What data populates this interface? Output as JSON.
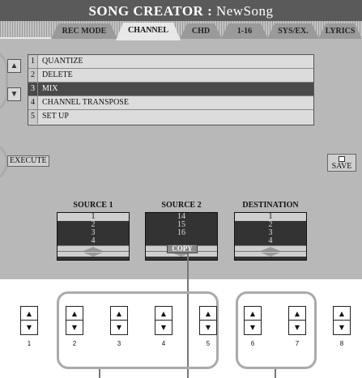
{
  "title": {
    "prefix": "SONG CREATOR : ",
    "name": "NewSong"
  },
  "tabs": [
    "REC MODE",
    "CHANNEL",
    "CHD",
    "1-16",
    "SYS/EX.",
    "LYRICS"
  ],
  "active_tab": "CHANNEL",
  "scroll": {
    "up": "▲",
    "down": "▼"
  },
  "menu": [
    {
      "num": "1",
      "label": "QUANTIZE"
    },
    {
      "num": "2",
      "label": "DELETE"
    },
    {
      "num": "3",
      "label": "MIX"
    },
    {
      "num": "4",
      "label": "CHANNEL TRANSPOSE"
    },
    {
      "num": "5",
      "label": "SET UP"
    }
  ],
  "selected_menu": "MIX",
  "execute_label": "EXECUTE",
  "save_label": "SAVE",
  "columns": [
    {
      "title": "SOURCE 1",
      "rows": [
        "1",
        "2",
        "3",
        "4"
      ],
      "selected": "1"
    },
    {
      "title": "SOURCE 2",
      "rows": [
        "14",
        "15",
        "16"
      ],
      "selected": ""
    },
    {
      "title": "DESTINATION",
      "rows": [
        "1",
        "2",
        "3",
        "4"
      ],
      "selected": "1"
    }
  ],
  "copy_label": "COPY",
  "buttons": [
    {
      "num": "1",
      "up": "▲",
      "down": "▼"
    },
    {
      "num": "2",
      "up": "▲",
      "down": "▼"
    },
    {
      "num": "3",
      "up": "▲",
      "down": "▼"
    },
    {
      "num": "4",
      "up": "▲",
      "down": "▼"
    },
    {
      "num": "5",
      "up": "▲",
      "down": "▼"
    },
    {
      "num": "6",
      "up": "▲",
      "down": "▼"
    },
    {
      "num": "7",
      "up": "▲",
      "down": "▼"
    },
    {
      "num": "8",
      "up": "▲",
      "down": "▼"
    }
  ],
  "colors": {
    "lcd_bg": "#b8b8b8",
    "title_bg": "#5a5a5a",
    "selected_row": "#4a4a4a",
    "highlight_outline": "#aaaaaa"
  }
}
